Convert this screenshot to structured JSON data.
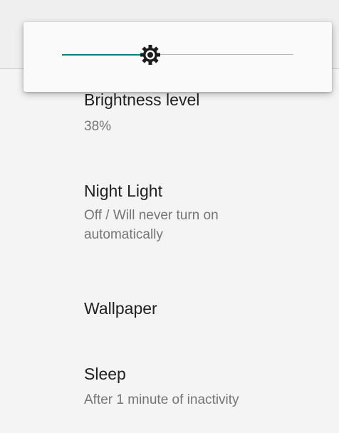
{
  "brightness_slider": {
    "level_fraction": 0.38,
    "accent_color": "#00897b",
    "thumb_icon": "brightness-icon"
  },
  "settings": {
    "brightness": {
      "title": "Brightness level",
      "summary": "38%"
    },
    "night_light": {
      "title": "Night Light",
      "summary": "Off / Will never turn on automatically"
    },
    "wallpaper": {
      "title": "Wallpaper"
    },
    "sleep": {
      "title": "Sleep",
      "summary": "After 1 minute of inactivity"
    }
  }
}
